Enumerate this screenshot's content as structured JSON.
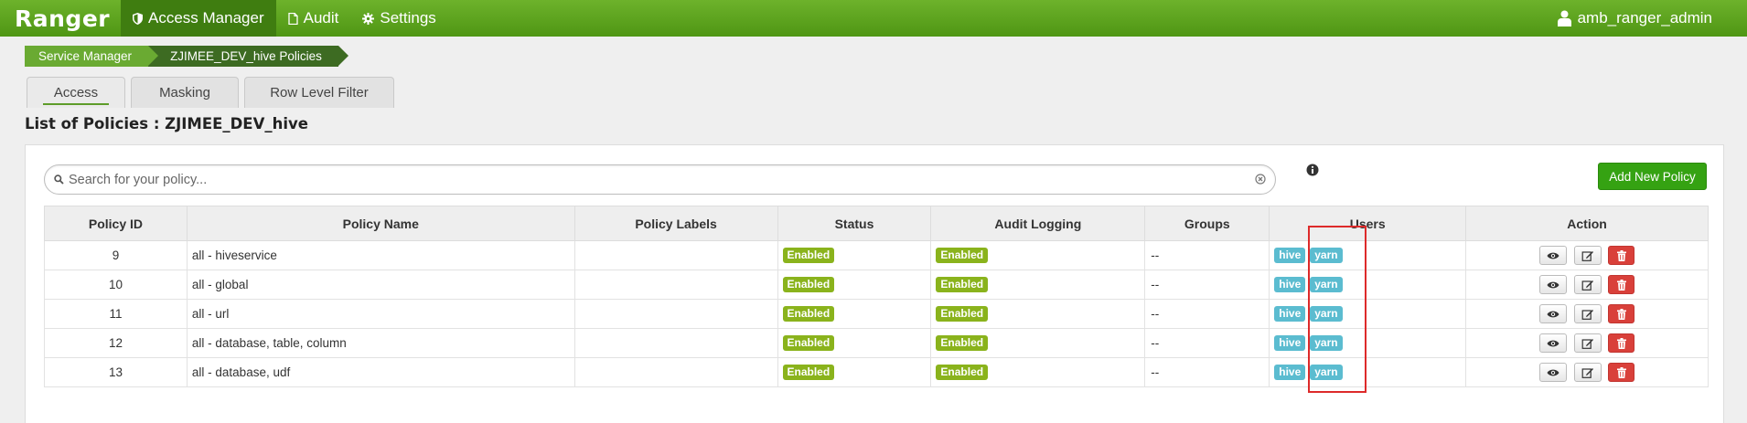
{
  "nav": {
    "brand": "Ranger",
    "items": [
      {
        "label": "Access Manager",
        "icon": "shield-icon"
      },
      {
        "label": "Audit",
        "icon": "document-icon"
      },
      {
        "label": "Settings",
        "icon": "gear-icon"
      }
    ],
    "user": "amb_ranger_admin"
  },
  "breadcrumb": [
    "Service Manager",
    "ZJIMEE_DEV_hive Policies"
  ],
  "tabs": [
    "Access",
    "Masking",
    "Row Level Filter"
  ],
  "title": "List of Policies : ZJIMEE_DEV_hive",
  "search": {
    "placeholder": "Search for your policy..."
  },
  "add_button": "Add New Policy",
  "table": {
    "headers": [
      "Policy ID",
      "Policy Name",
      "Policy Labels",
      "Status",
      "Audit Logging",
      "Groups",
      "Users",
      "Action"
    ],
    "rows": [
      {
        "id": "9",
        "name": "all - hiveservice",
        "labels": "",
        "status": "Enabled",
        "audit": "Enabled",
        "groups": "--",
        "users": [
          "hive",
          "yarn"
        ]
      },
      {
        "id": "10",
        "name": "all - global",
        "labels": "",
        "status": "Enabled",
        "audit": "Enabled",
        "groups": "--",
        "users": [
          "hive",
          "yarn"
        ]
      },
      {
        "id": "11",
        "name": "all - url",
        "labels": "",
        "status": "Enabled",
        "audit": "Enabled",
        "groups": "--",
        "users": [
          "hive",
          "yarn"
        ]
      },
      {
        "id": "12",
        "name": "all - database, table, column",
        "labels": "",
        "status": "Enabled",
        "audit": "Enabled",
        "groups": "--",
        "users": [
          "hive",
          "yarn"
        ]
      },
      {
        "id": "13",
        "name": "all - database, udf",
        "labels": "",
        "status": "Enabled",
        "audit": "Enabled",
        "groups": "--",
        "users": [
          "hive",
          "yarn"
        ]
      }
    ]
  },
  "colors": {
    "accent": "#4f9614",
    "enabled": "#8ab31c",
    "user_badge": "#5bbcd0",
    "highlight": "#dd2a2a"
  }
}
